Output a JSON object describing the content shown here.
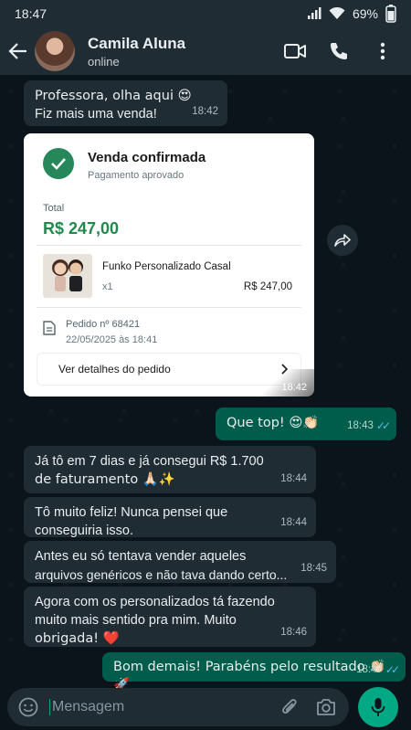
{
  "status_bar": {
    "time": "18:47",
    "battery": "69%"
  },
  "header": {
    "contact_name": "Camila Aluna",
    "presence": "online"
  },
  "messages": [
    {
      "direction": "in",
      "lines": [
        "Professora, olha aqui 😍",
        "Fiz mais uma venda!"
      ],
      "time": "18:42"
    },
    {
      "direction": "out",
      "lines": [
        "Que top! 😍👏🏻"
      ],
      "time": "18:43"
    },
    {
      "direction": "in",
      "lines": [
        "Já tô em 7 dias e já consegui R$ 1.700",
        "de faturamento 🙏🏻✨"
      ],
      "time": "18:44"
    },
    {
      "direction": "in",
      "lines": [
        "Tô muito feliz! Nunca pensei que",
        "conseguiria isso."
      ],
      "time": "18:44"
    },
    {
      "direction": "in",
      "lines": [
        "Antes eu só tentava vender aqueles",
        "arquivos genéricos e não tava dando certo..."
      ],
      "time": "18:45"
    },
    {
      "direction": "in",
      "lines": [
        "Agora com os personalizados tá fazendo",
        "muito mais sentido pra mim. Muito",
        "obrigada! ❤️"
      ],
      "time": "18:46"
    },
    {
      "direction": "out",
      "lines": [
        "Bom demais! Parabéns pelo resultado 👏🏻🚀"
      ],
      "time": "18:47"
    }
  ],
  "order_card": {
    "title": "Venda confirmada",
    "subtitle": "Pagamento aprovado",
    "total_label": "Total",
    "total_value": "R$ 247,00",
    "product_name": "Funko Personalizado Casal",
    "product_qty": "x1",
    "product_price": "R$ 247,00",
    "order_number": "Pedido nº 68421",
    "order_date": "22/05/2025 às 18:41",
    "details_label": "Ver detalhes do pedido",
    "time": "18:42"
  },
  "composer": {
    "placeholder": "Mensagem"
  },
  "colors": {
    "outgoing": "#005c4b",
    "incoming": "#202c33",
    "accent": "#00a884",
    "header": "#1f2c34",
    "read_ticks": "#53bdeb"
  },
  "icons": [
    "back-arrow-icon",
    "video-call-icon",
    "phone-icon",
    "more-vert-icon",
    "check-circle-icon",
    "document-icon",
    "chevron-right-icon",
    "share-forward-icon",
    "emoji-icon",
    "attach-icon",
    "camera-icon",
    "mic-icon"
  ]
}
